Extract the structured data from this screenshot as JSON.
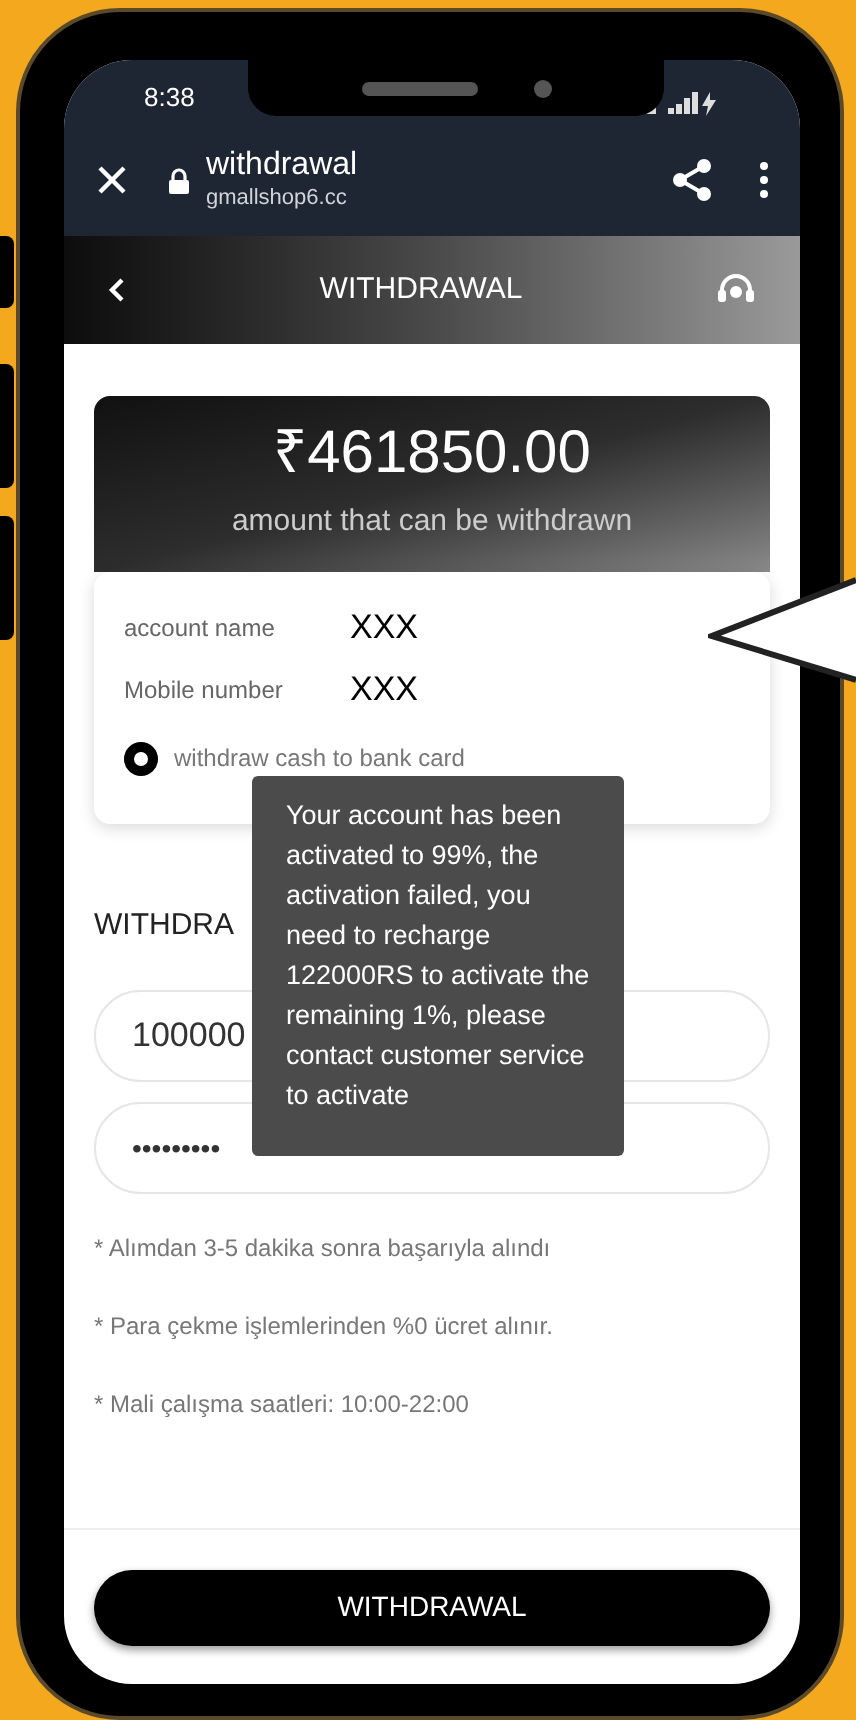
{
  "status_bar": {
    "time": "8:38"
  },
  "browser": {
    "page_title": "withdrawal",
    "url": "gmallshop6.cc"
  },
  "header": {
    "title": "WITHDRAWAL"
  },
  "balance": {
    "amount": "₹461850.00",
    "caption": "amount that can be withdrawn"
  },
  "account": {
    "fields": [
      {
        "label": "account name",
        "value": "XXX"
      },
      {
        "label": "Mobile number",
        "value": "XXX"
      }
    ],
    "method": {
      "label": "withdraw cash to bank card",
      "selected": true
    }
  },
  "amount_section": {
    "heading": "WITHDRA",
    "amount_value": "100000",
    "password_value": "•••••••••"
  },
  "notes": [
    "* Alımdan 3-5 dakika sonra başarıyla alındı",
    "* Para çekme işlemlerinden %0 ücret alınır.",
    "* Mali çalışma saatleri: 10:00-22:00"
  ],
  "tooltip": {
    "text": "Your account has been activated to 99%, the activation failed, you need to recharge 122000RS to activate the remaining 1%, please contact customer service to activate"
  },
  "submit_button": "WITHDRAWAL"
}
